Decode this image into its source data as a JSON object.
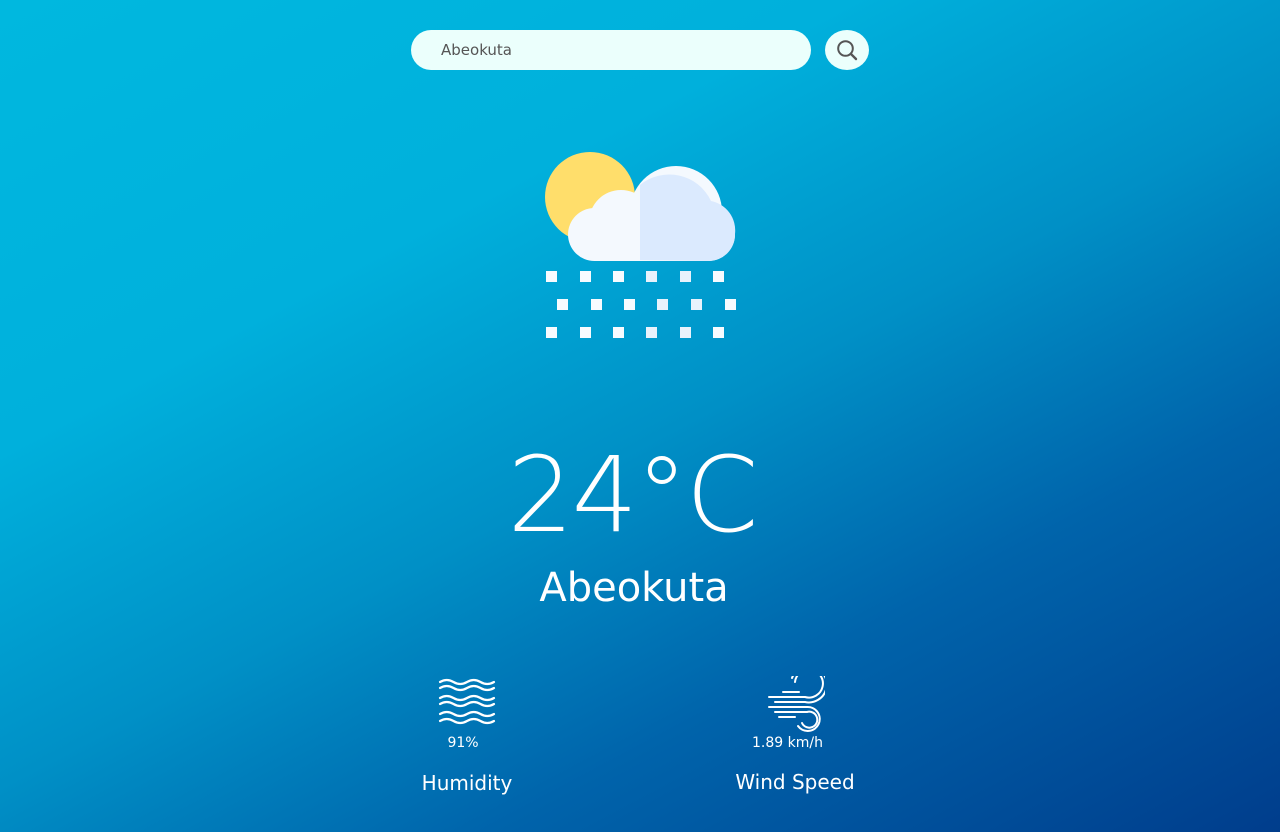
{
  "search": {
    "value": "Abeokuta",
    "icon": "search-icon"
  },
  "weather": {
    "icon": "sun-cloud-snow-icon",
    "temperature": "24°C",
    "city": "Abeokuta"
  },
  "details": {
    "humidity": {
      "icon": "humidity-waves-icon",
      "value": "91%",
      "label": "Humidity"
    },
    "wind": {
      "icon": "wind-icon",
      "value": "1.89 km/h",
      "label": "Wind Speed"
    }
  },
  "colors": {
    "gradient_start": "#00b8df",
    "gradient_end": "#003d8c",
    "search_bg": "#ebfffc",
    "sun": "#ffde6b",
    "cloud_light": "#f4f9fe",
    "cloud_shade": "#dbeafe"
  }
}
